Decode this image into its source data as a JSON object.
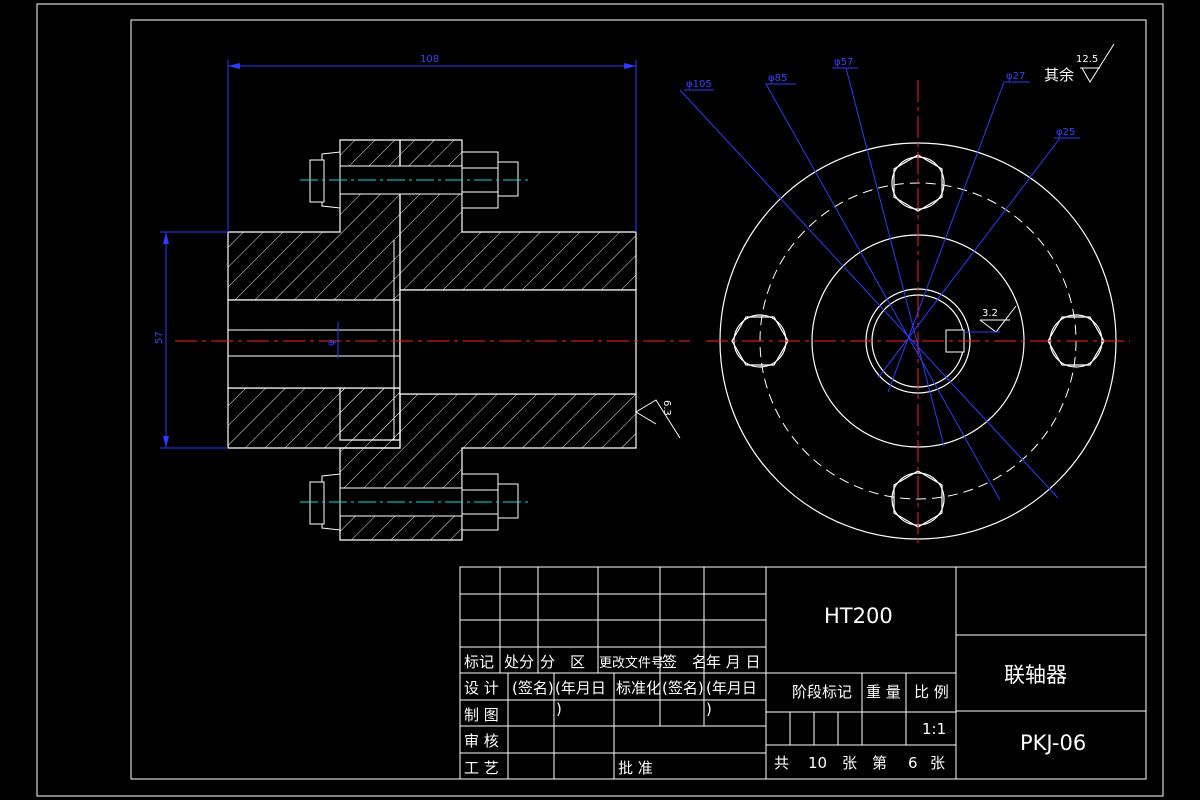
{
  "colors": {
    "background": "#000000",
    "outline": "#ffffff",
    "dimension": "#2a3cff",
    "centerline": "#ff2020",
    "axis": "#00e0e0"
  },
  "dimensions": {
    "length": "108",
    "outer_dia": "φ105",
    "d85": "φ85",
    "d57": "φ57",
    "d27": "φ27",
    "d25": "φ25",
    "shaft_dia": "φ",
    "left_height": "57",
    "roughness_main": "6.3",
    "roughness_key": "3.2",
    "roughness_rest_label": "其余",
    "roughness_rest": "12.5"
  },
  "title_block": {
    "material": "HT200",
    "part_name": "联轴器",
    "drawing_no": "PKJ-06",
    "scale": "1:1",
    "header": {
      "c1": "标记",
      "c2": "处分",
      "c3": "分　区",
      "c4": "更改文件号",
      "c5": "签　名",
      "c6": "年 月 日"
    },
    "row_design": {
      "label": "设 计",
      "sig": "(签名)",
      "date": "(年月日",
      "std": "标准化",
      "sig2": "(签名)",
      "date2": "(年月日"
    },
    "row_draw": {
      "label": "制 图",
      "paren1": ")",
      "paren2": ")"
    },
    "row_review": {
      "label": "审 核"
    },
    "row_craft": {
      "label": "工 艺",
      "approve": "批 准"
    },
    "stage_label": "阶段标记",
    "weight_label": "重 量",
    "scale_label": "比 例",
    "sheet": {
      "total_pre": "共",
      "total": "10",
      "total_post": "张",
      "num_pre": "第",
      "num": "6",
      "num_post": "张"
    }
  }
}
